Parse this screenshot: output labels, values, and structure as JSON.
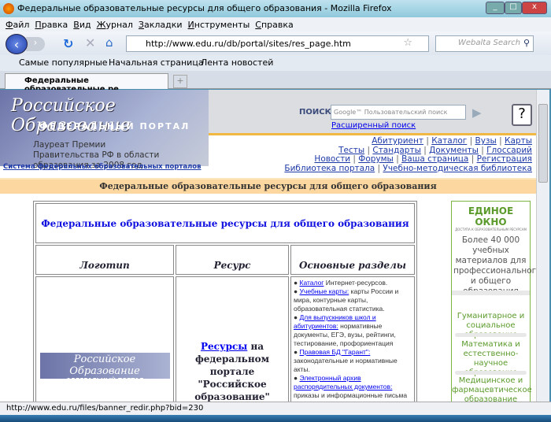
{
  "window": {
    "title": "Федеральные образовательные ресурсы для общего образования - Mozilla Firefox"
  },
  "menu": [
    "Файл",
    "Правка",
    "Вид",
    "Журнал",
    "Закладки",
    "Инструменты",
    "Справка"
  ],
  "toolbar": {
    "url": "http://www.edu.ru/db/portal/sites/res_page.htm",
    "search_placeholder": "Webalta Search"
  },
  "bookmarks": [
    "Самые популярные",
    "Начальная страница",
    "Лента новостей"
  ],
  "tab": {
    "label": "Федеральные образовательные ре...",
    "new_tab": "+"
  },
  "header": {
    "logo_title": "Российское Образование",
    "logo_subtitle": "ФЕДЕРАЛЬНЫЙ ПОРТАЛ",
    "laureate": "Лауреат Премии Правительства РФ в области образования за 2008 год",
    "search_label": "ПОИСК",
    "search_placeholder": "Google™ Пользовательский поиск",
    "advanced_search": "Расширенный поиск",
    "help": "?",
    "system_link": "Система федеральных образовательных порталов",
    "nav_rows": [
      [
        "Абитуриент",
        "Каталог",
        "Вузы",
        "Карты"
      ],
      [
        "Тесты",
        "Стандарты",
        "Документы",
        "Глоссарий"
      ],
      [
        "Новости",
        "Форумы",
        "Ваша страница",
        "Регистрация"
      ],
      [
        "Библиотека портала",
        "Учебно-методическая библиотека"
      ]
    ]
  },
  "page": {
    "heading": "Федеральные образовательные ресурсы для общего образования",
    "table": {
      "title": "Федеральные образовательные ресурсы для общего образования",
      "columns": [
        "Логотип",
        "Ресурс",
        "Основные разделы"
      ],
      "row": {
        "logo_title": "Российское Образование",
        "logo_subtitle": "ФЕДЕРАЛЬНЫЙ ПОРТАЛ",
        "resource_link": "Ресурсы",
        "resource_text": " на федеральном портале \"Российское образование\"",
        "sections": [
          {
            "link": "Каталог",
            "text": " Интернет-ресурсов."
          },
          {
            "link": "Учебные карты:",
            "text": " карты России и мира, контурные карты, образовательная статистика."
          },
          {
            "link": "Для выпускников школ и абитуриентов:",
            "text": " нормативные документы, ЕГЭ, вузы, рейтинги, тестирование, профориентация"
          },
          {
            "link": "Правовая БД \"Гарант\":",
            "text": " законодательные и нормативные акты."
          },
          {
            "link": "Электронный архив распорядительных документов:",
            "text": " приказы и информационные письма"
          }
        ]
      }
    }
  },
  "side_banner": {
    "brand": "ЕДИНОЕ ОКНО",
    "brand_sub": "ДОСТУПА К ОБРАЗОВАТЕЛЬНЫМ РЕСУРСАМ",
    "text": "Более 40 000 учебных материалов для профессионального и общего образования",
    "links": [
      "Гуманитарное и социальное образование",
      "Математика и естественно-научное образование",
      "Медицинское и фармацевтическое образование"
    ]
  },
  "status": "http://www.edu.ru/files/banner_redir.php?bid=230"
}
